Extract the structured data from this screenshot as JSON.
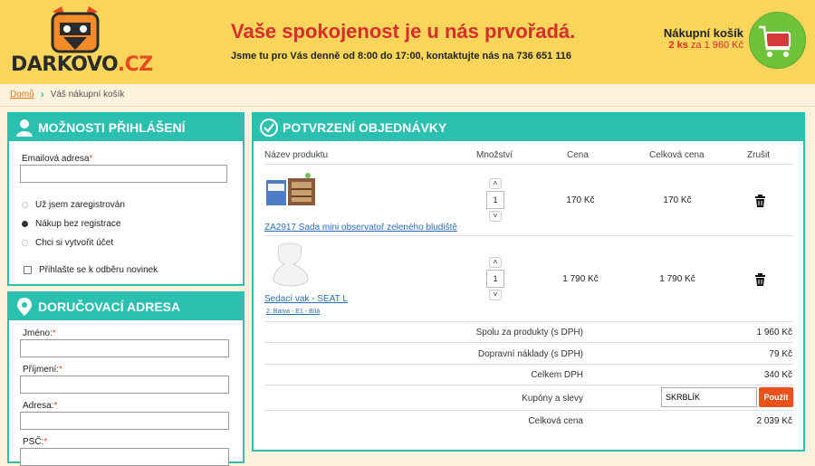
{
  "header": {
    "logo_main": "DARKOVO",
    "logo_tld": ".CZ",
    "slogan": "Vaše spokojenost je u nás prvořadá.",
    "hours": "Jsme tu pro Vás denně od 8:00 do 17:00, kontaktujte nás na 736 651 116",
    "cart_title": "Nákupní košík",
    "cart_count": "2 ks",
    "cart_sep": " za ",
    "cart_total": "1 960 Kč"
  },
  "breadcrumb": {
    "home": "Domů",
    "current": "Váš nákupní košík"
  },
  "login": {
    "title": "MOŽNOSTI PŘIHLÁŠENÍ",
    "email_label": "Emailová adresa",
    "email_value": "",
    "options": [
      {
        "label": "Už jsem zaregistrován",
        "selected": false
      },
      {
        "label": "Nákup bez registrace",
        "selected": true
      },
      {
        "label": "Chci si vytvořit účet",
        "selected": false
      }
    ],
    "newsletter_label": "Přihlašte se k odběru novinek"
  },
  "delivery": {
    "title": "DORUČOVACÍ ADRESA",
    "fields": [
      "Jméno:",
      "Příjmení:",
      "Adresa:",
      "PSČ:"
    ]
  },
  "order": {
    "title": "POTVRZENÍ OBJEDNÁVKY",
    "columns": [
      "Název produktu",
      "Množství",
      "Cena",
      "Celková cena",
      "Zrušit"
    ],
    "items": [
      {
        "name": "ZA2917 Sada mini observatoř zeleného bludiště",
        "variant": "",
        "qty": "1",
        "price": "170 Kč",
        "total": "170 Kč"
      },
      {
        "name": "Sedací vak - SEAT L",
        "variant": "2. Barva - E1 - Bílá",
        "qty": "1",
        "price": "1 790 Kč",
        "total": "1 790 Kč"
      }
    ],
    "summary": [
      {
        "label": "Spolu za produkty (s DPH)",
        "value": "1 960 Kč"
      },
      {
        "label": "Dopravní náklady (s DPH)",
        "value": "79 Kč"
      },
      {
        "label": "Celkem DPH",
        "value": "340 Kč"
      },
      {
        "label": "Kupóny a slevy",
        "value": ""
      },
      {
        "label": "Celková cena",
        "value": "2 039 Kč"
      }
    ],
    "coupon_value": "SKRBLÍK",
    "apply_label": "Použít"
  },
  "colors": {
    "teal": "#2bbfb0",
    "header_yellow": "#f9d55c",
    "slogan_red": "#d62d2d",
    "button_orange": "#e8531d"
  }
}
